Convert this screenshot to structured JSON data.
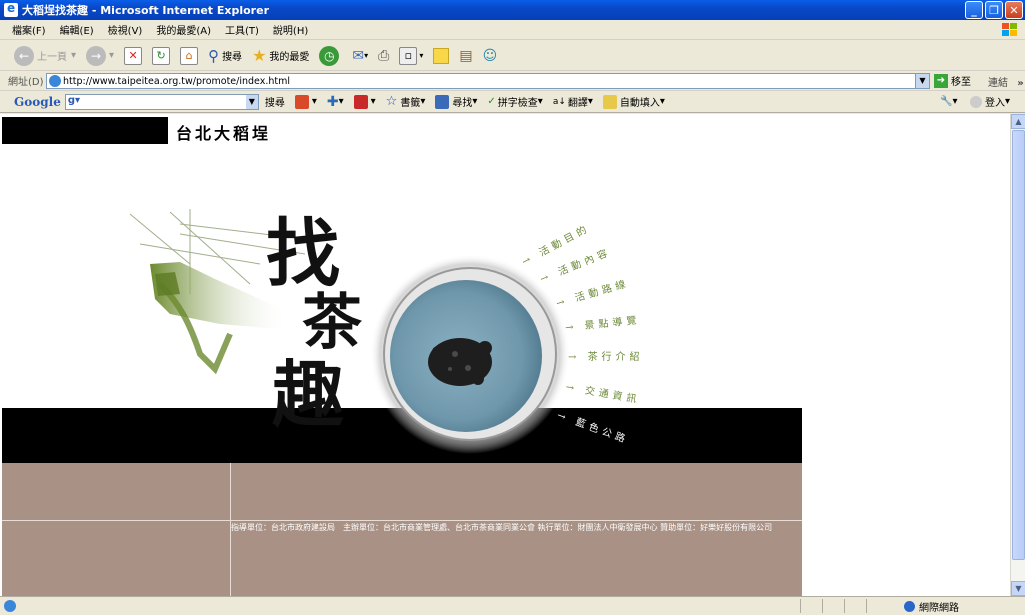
{
  "window": {
    "title": "大稻埕找茶趣 - Microsoft Internet Explorer",
    "minimize": "_",
    "restore": "❐",
    "close": "✕"
  },
  "menu": [
    "檔案(F)",
    "編輯(E)",
    "檢視(V)",
    "我的最愛(A)",
    "工具(T)",
    "說明(H)"
  ],
  "toolbar": {
    "back": "上一頁",
    "search": "搜尋",
    "favorites": "我的最愛"
  },
  "address": {
    "label": "網址(D)",
    "url": "http://www.taipeitea.org.tw/promote/index.html",
    "go": "移至",
    "links": "連結",
    "more": "»"
  },
  "google": {
    "logo": "Google",
    "search": "搜尋",
    "bookmarks": "書籤",
    "find": "尋找",
    "spell": "拼字檢查",
    "translate": "翻譯",
    "autofill": "自動填入",
    "login": "登入"
  },
  "page": {
    "site_name": "台北大稻埕",
    "big_title": [
      "找",
      "茶",
      "趣"
    ],
    "menu_items": [
      {
        "label": "活動目的"
      },
      {
        "label": "活動內容"
      },
      {
        "label": "活動路線"
      },
      {
        "label": "景點導覽"
      },
      {
        "label": "茶行介紹"
      },
      {
        "label": "交通資訊"
      },
      {
        "label": "藍色公路"
      }
    ],
    "footer": "指導單位：台北市政府建設局　主辦單位：台北市商業管理處、台北市茶商業同業公會 執行單位：財團法人中衛發展中心 贊助單位：好樂好股份有限公司"
  },
  "status": {
    "zone": "網際網路"
  },
  "colors": {
    "footer_bg": "#a99285",
    "menu_green": "#6e8a3a",
    "bowl_blue": "#6f97ab"
  }
}
